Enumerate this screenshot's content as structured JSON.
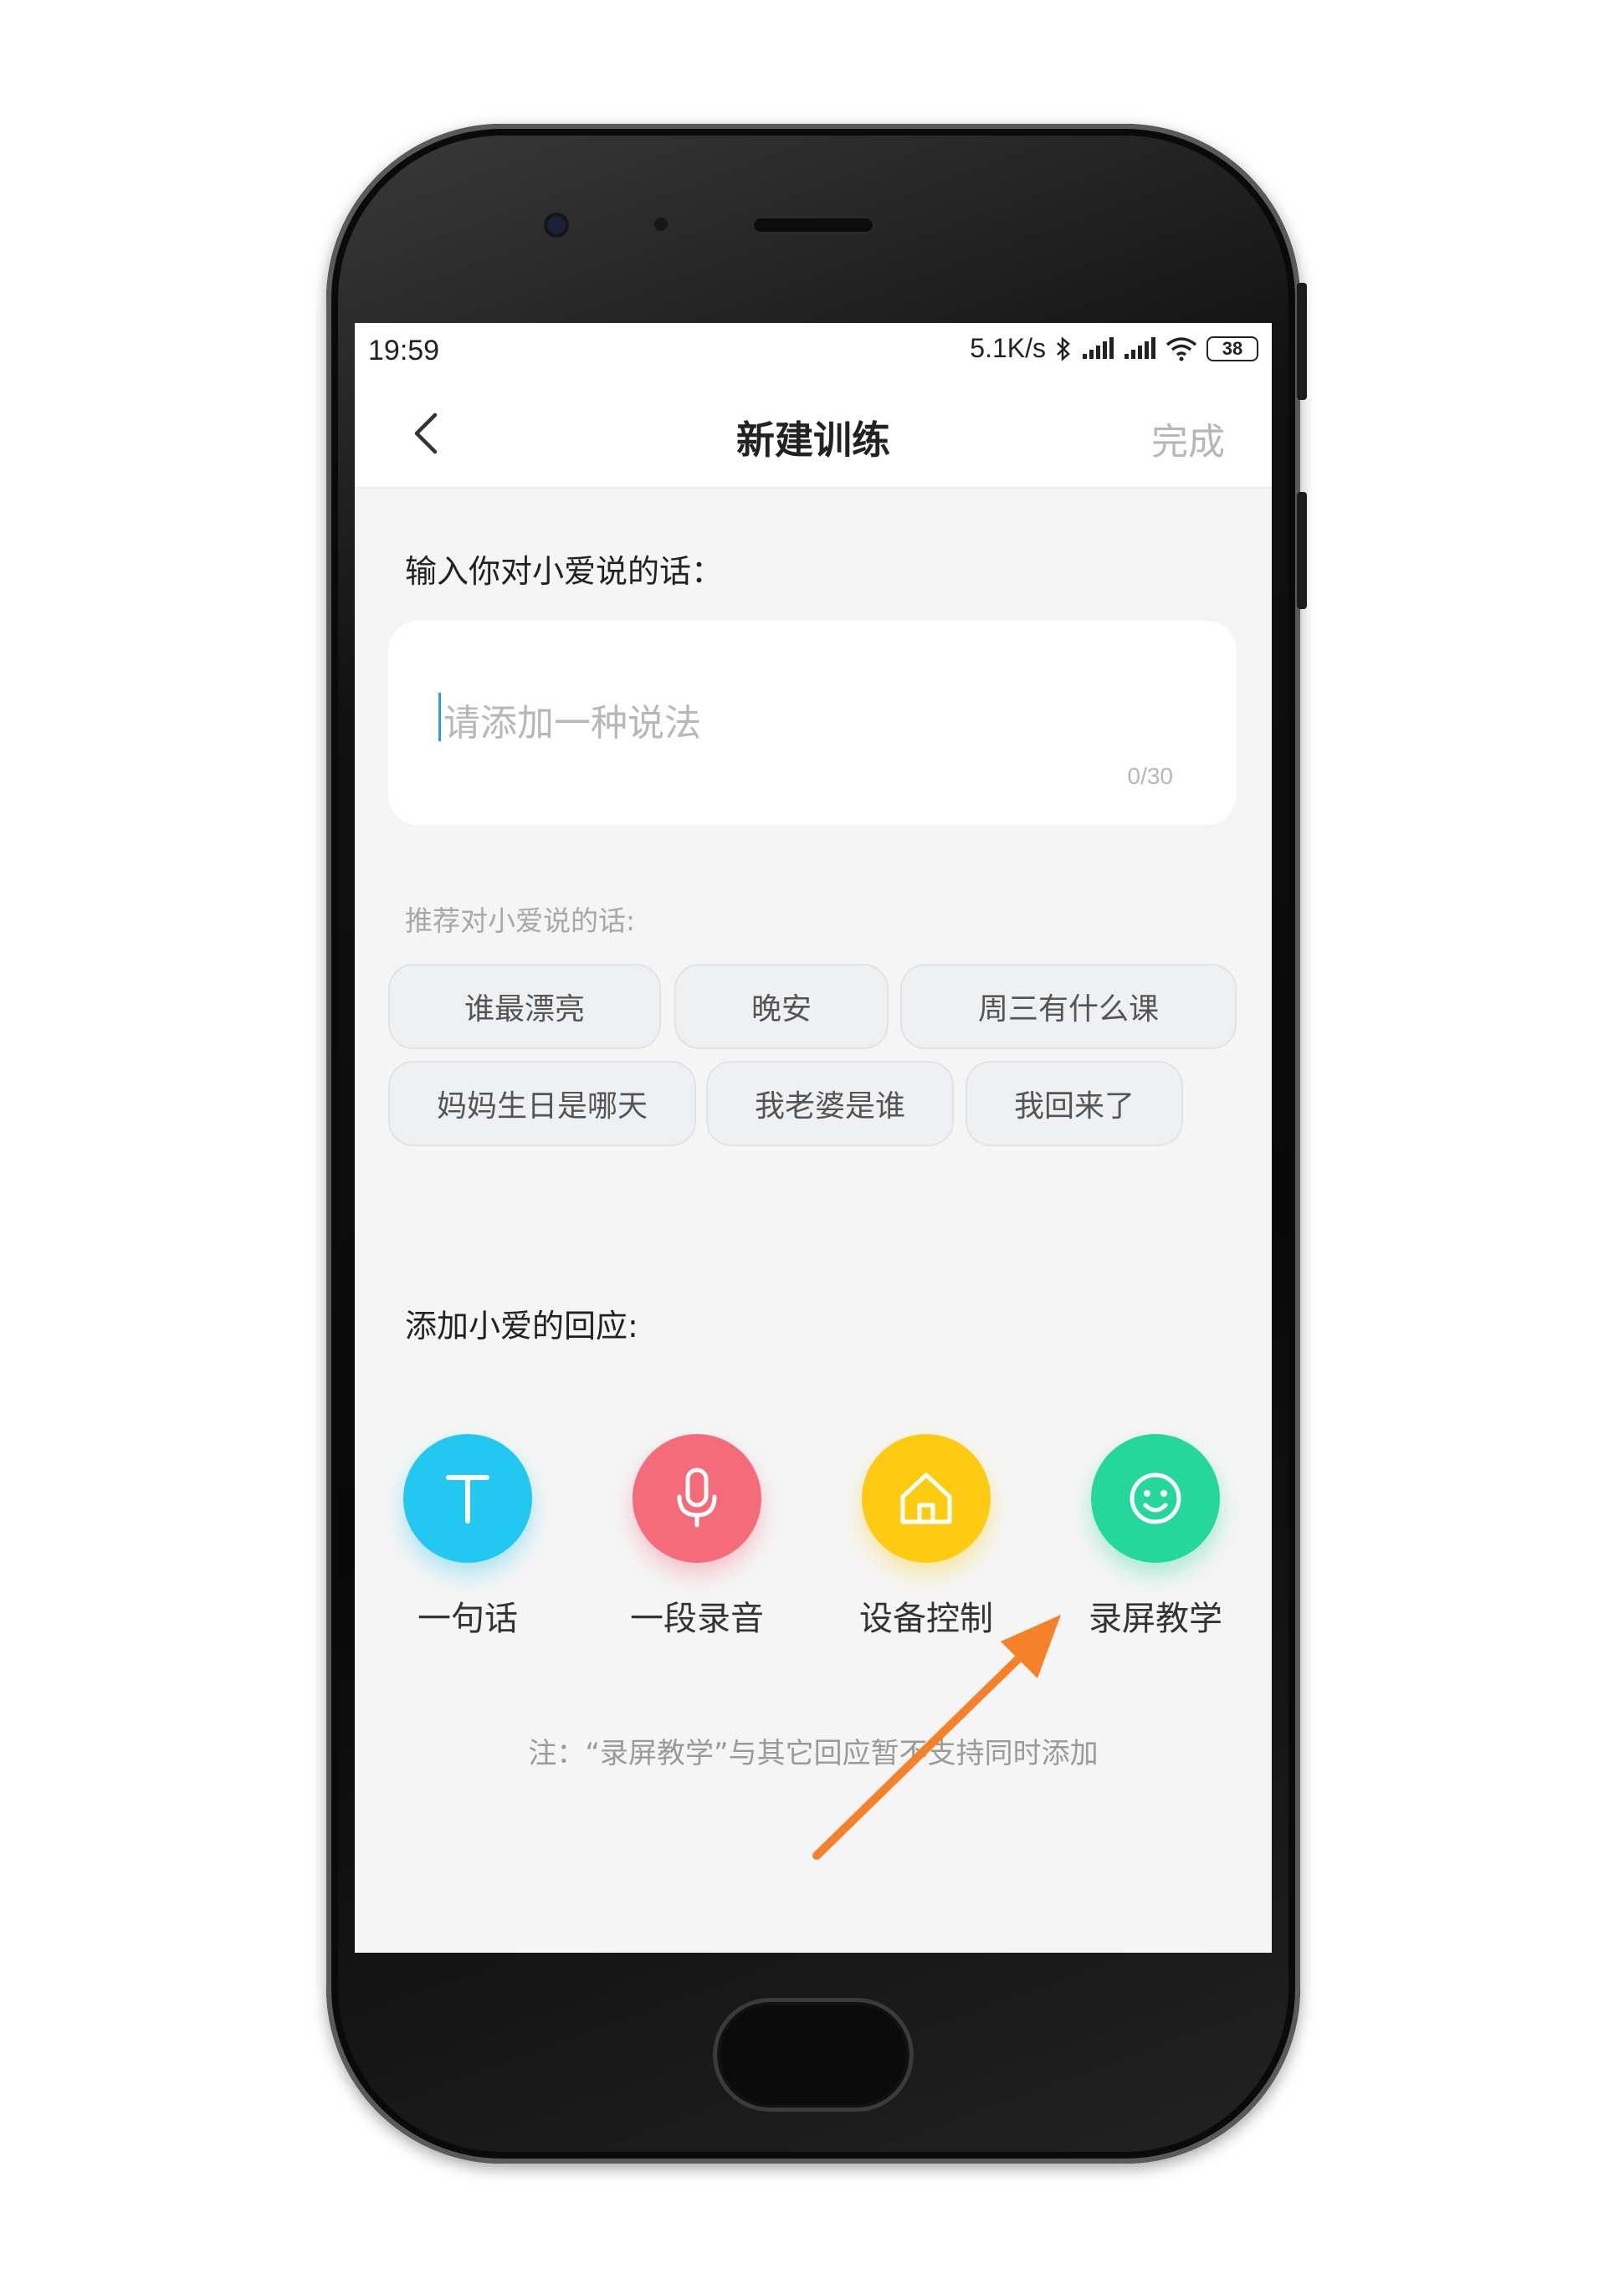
{
  "status_bar": {
    "time": "19:59",
    "network_speed": "5.1K/s",
    "battery": "38"
  },
  "navbar": {
    "title": "新建训练",
    "done_label": "完成"
  },
  "input_section": {
    "label": "输入你对小爱说的话：",
    "placeholder": "请添加一种说法",
    "counter": "0/30"
  },
  "recommend": {
    "label": "推荐对小爱说的话:",
    "chips": [
      "谁最漂亮",
      "晚安",
      "周三有什么课",
      "妈妈生日是哪天",
      "我老婆是谁",
      "我回来了"
    ]
  },
  "response": {
    "label": "添加小爱的回应:",
    "options": [
      {
        "label": "一句话",
        "icon": "text-icon",
        "color": "#23c8f0"
      },
      {
        "label": "一段录音",
        "icon": "microphone-icon",
        "color": "#f46b7a"
      },
      {
        "label": "设备控制",
        "icon": "home-icon",
        "color": "#fdcb12"
      },
      {
        "label": "录屏教学",
        "icon": "smiley-icon",
        "color": "#25d79a"
      }
    ],
    "note": "注：“录屏教学”与其它回应暂不支持同时添加"
  },
  "annotation": {
    "arrow_color": "#f5812a"
  }
}
